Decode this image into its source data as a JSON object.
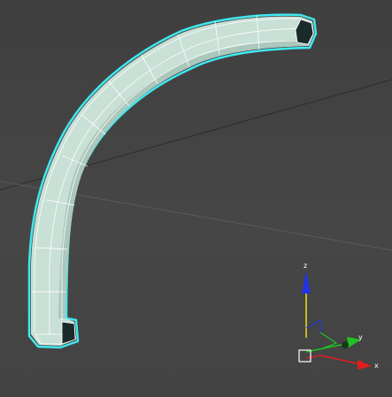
{
  "viewport": {
    "background": "#444444",
    "grid_color": "#2c2c2c",
    "grid_color_secondary": "#5a5a5a"
  },
  "object": {
    "type": "curved tube (bend)",
    "selected": true,
    "fill_color": "#c9e0d6",
    "shade_color": "#9bb8ac",
    "wire_color": "#ffffff",
    "selection_outline_color": "#3fe8f0",
    "end_cap_color": "#1b2b2b"
  },
  "gizmo": {
    "x_label": "x",
    "y_label": "y",
    "z_label": "z",
    "x_color": "#e01e1e",
    "y_color": "#22c322",
    "z_color": "#2233e0",
    "z_stem_color": "#f0e010",
    "pivot_box_icon": "square-icon"
  }
}
